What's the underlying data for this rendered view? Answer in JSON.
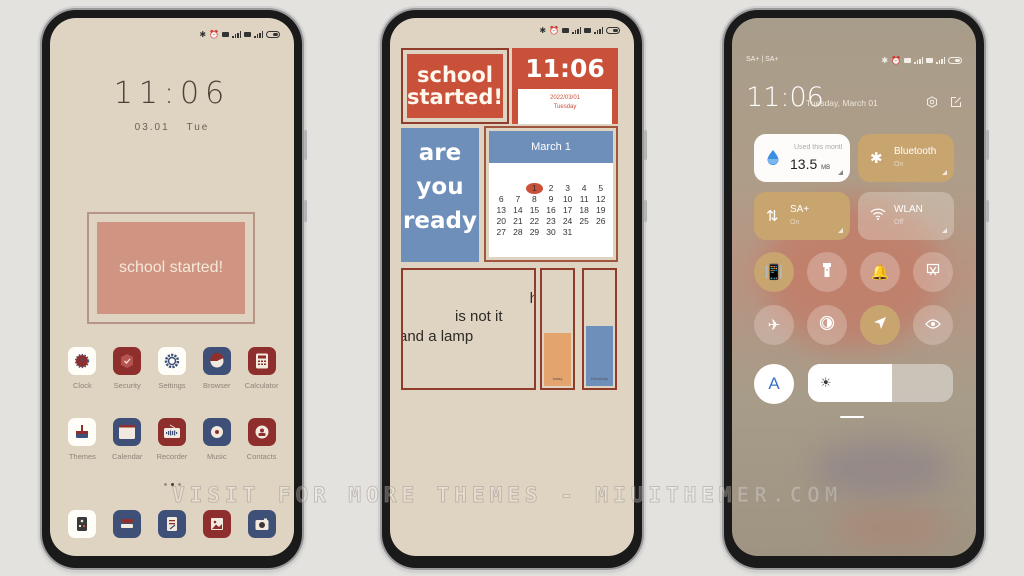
{
  "status_bar": {
    "icons": [
      "bluetooth-icon",
      "alarm-icon",
      "sim1-icon",
      "signal1-icon",
      "sim2-icon",
      "signal2-icon",
      "battery-icon"
    ]
  },
  "phone1": {
    "clock_time": "11:06",
    "date": "03.01",
    "weekday": "Tue",
    "widget_text": "school started!",
    "apps_row1": [
      {
        "label": "Clock",
        "icon": "clock-icon"
      },
      {
        "label": "Security",
        "icon": "shield-icon"
      },
      {
        "label": "Settings",
        "icon": "gear-icon"
      },
      {
        "label": "Browser",
        "icon": "browser-icon"
      },
      {
        "label": "Calculator",
        "icon": "calculator-icon"
      }
    ],
    "apps_row2": [
      {
        "label": "Themes",
        "icon": "brush-icon"
      },
      {
        "label": "Calendar",
        "icon": "calendar-icon"
      },
      {
        "label": "Recorder",
        "icon": "radio-icon"
      },
      {
        "label": "Music",
        "icon": "music-icon"
      },
      {
        "label": "Contacts",
        "icon": "contact-icon"
      }
    ],
    "dock": [
      {
        "icon": "phone-icon"
      },
      {
        "icon": "messages-icon"
      },
      {
        "icon": "notes-icon"
      },
      {
        "icon": "gallery-icon"
      },
      {
        "icon": "camera-icon"
      }
    ],
    "page_indicator": {
      "count": 3,
      "active": 2
    }
  },
  "phone2": {
    "school_widget": "school started!",
    "clock_time": "11:06",
    "clock_date": "2022/03/01",
    "clock_weekday": "Tuesday",
    "ready_lines": [
      "are",
      "you",
      "ready"
    ],
    "calendar": {
      "title": "March 1",
      "leading_blanks": 2,
      "days": 31,
      "today": 1
    },
    "lamp_widget": {
      "line1": "is not it",
      "line2": "and a lamp",
      "partial": "h"
    },
    "bars": [
      {
        "label": "today",
        "level_percent": 48
      },
      {
        "label": "Electricity",
        "level_percent": 54
      }
    ]
  },
  "phone3": {
    "carrier": "SA+ | SA+",
    "time": "11:06",
    "date": "Tuesday, March 01",
    "data_tile": {
      "caption": "Used this month",
      "value": "13.5",
      "unit": "MB"
    },
    "tiles": [
      {
        "title": "Bluetooth",
        "state": "On"
      },
      {
        "title": "SA+",
        "state": "On"
      },
      {
        "title": "WLAN",
        "state": "Off"
      }
    ],
    "toggles": [
      {
        "name": "vibrate",
        "on": true
      },
      {
        "name": "flashlight",
        "on": false
      },
      {
        "name": "sound",
        "on": false
      },
      {
        "name": "screenshot",
        "on": false
      },
      {
        "name": "airplane",
        "on": false
      },
      {
        "name": "dark-mode",
        "on": false
      },
      {
        "name": "location",
        "on": true
      },
      {
        "name": "reading-mode",
        "on": false
      }
    ],
    "auto_brightness_label": "A",
    "brightness_percent": 58
  },
  "watermark": "VISIT FOR MORE THEMES - MIUITHEMER.COM"
}
